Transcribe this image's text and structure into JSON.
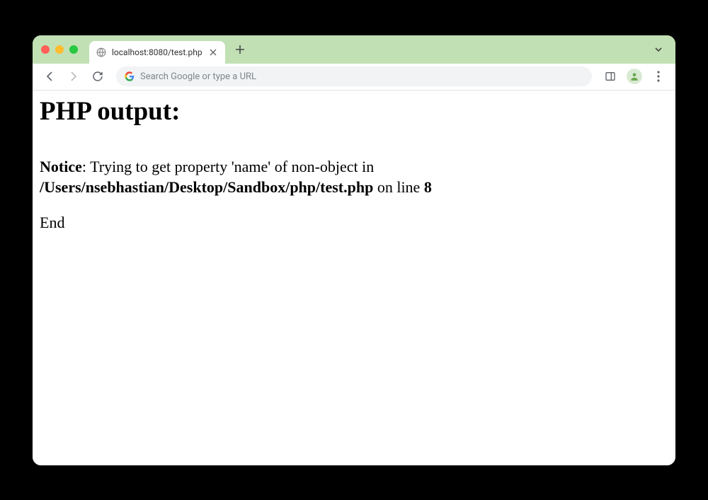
{
  "tab": {
    "title": "localhost:8080/test.php"
  },
  "omnibox": {
    "placeholder": "Search Google or type a URL"
  },
  "page": {
    "heading": "PHP output:",
    "notice_label": "Notice",
    "notice_message": ": Trying to get property 'name' of non-object in ",
    "notice_file": "/Users/nsebhastian/Desktop/Sandbox/php/test.php",
    "notice_on_line": " on line ",
    "notice_line_number": "8",
    "end_text": "End"
  }
}
